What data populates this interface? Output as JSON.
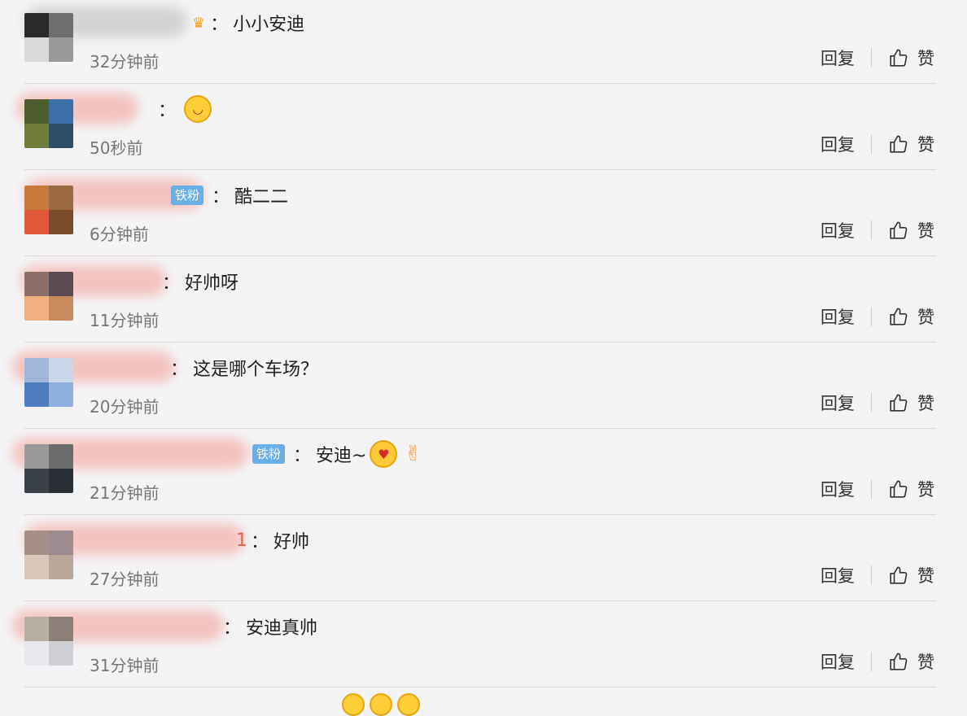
{
  "comments": [
    {
      "name_tail": "",
      "emoji_before": "crown",
      "text": "小小安迪",
      "time": "32分钟前",
      "avatar": [
        "#2b2b2b",
        "#6f6f6f",
        "#d9d9d9",
        "#9a9a9a"
      ],
      "blur": "#c9c9c9"
    },
    {
      "name_tail": "",
      "emoji_after": "laugh",
      "text": "",
      "time": "50秒前",
      "avatar": [
        "#4d5b2f",
        "#3a6ea5",
        "#6f7c3a",
        "#2e4d66"
      ],
      "blur": "#f4b3ad"
    },
    {
      "name_tail": "",
      "badge": "铁粉",
      "text": "酷二二",
      "time": "6分钟前",
      "avatar": [
        "#c87a3d",
        "#9c6a40",
        "#e05a3a",
        "#7b4a2a"
      ],
      "blur": "#f4b3ad"
    },
    {
      "name_tail": "",
      "text": "好帅呀",
      "time": "11分钟前",
      "avatar": [
        "#8d6e66",
        "#5c4a52",
        "#f0b080",
        "#c98a5e"
      ],
      "blur": "#f4b3ad"
    },
    {
      "name_tail": "",
      "text": "这是哪个车场？",
      "time": "20分钟前",
      "avatar": [
        "#9fb6d8",
        "#c9d7ea",
        "#4f7cbf",
        "#8fb0de"
      ],
      "blur": "#f4b3ad"
    },
    {
      "name_tail": "",
      "badge": "铁粉",
      "text": "安迪~",
      "emojis_after": [
        "kiss",
        "peace"
      ],
      "time": "21分钟前",
      "avatar": [
        "#9a9a9a",
        "#6b6b6b",
        "#3b4148",
        "#2a2f35"
      ],
      "blur": "#f4b3ad"
    },
    {
      "name_tail": "1",
      "text": "好帅",
      "time": "27分钟前",
      "avatar": [
        "#a58f87",
        "#9d8a8f",
        "#d8c6b8",
        "#b9a89a"
      ],
      "blur": "#f4b3ad"
    },
    {
      "name_tail": "",
      "text": "安迪真帅",
      "time": "31分钟前",
      "avatar": [
        "#b7aea4",
        "#8c7f77",
        "#e8e8ee",
        "#cfcfd6"
      ],
      "blur": "#f4b3ad"
    }
  ],
  "labels": {
    "reply": "回复",
    "like": "赞",
    "badge": "铁粉"
  }
}
